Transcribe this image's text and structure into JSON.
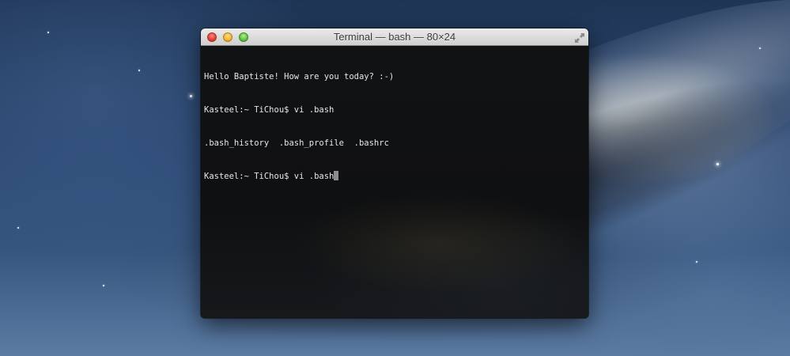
{
  "desktop": {
    "wallpaper": "galaxy"
  },
  "terminal": {
    "title": "Terminal — bash — 80×24",
    "lines": [
      "Hello Baptiste! How are you today? :-)",
      "Kasteel:~ TiChou$ vi .bash",
      ".bash_history  .bash_profile  .bashrc",
      "Kasteel:~ TiChou$ vi .bash"
    ],
    "colors": {
      "background": "#0d0e0f",
      "text": "#e6e6e6",
      "cursor": "#9a9a9a"
    }
  }
}
